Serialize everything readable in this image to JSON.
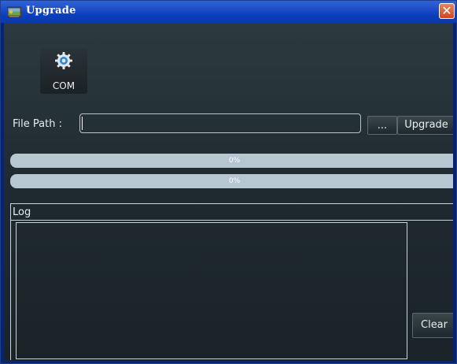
{
  "window": {
    "title": "Upgrade",
    "close_glyph": "✕"
  },
  "toolbar": {
    "com_label": "COM",
    "com_icon": "gear-icon"
  },
  "file_path": {
    "label": "File Path :",
    "value": "",
    "placeholder": ""
  },
  "buttons": {
    "browse": "...",
    "upgrade": "Upgrade",
    "clear": "Clear"
  },
  "progress": [
    {
      "value": 0,
      "label": "0%"
    },
    {
      "value": 0,
      "label": "0%"
    }
  ],
  "log": {
    "header": "Log",
    "content": ""
  },
  "colors": {
    "titlebar": "#1f4fc8",
    "close": "#d2461f",
    "background": "#1f2a30",
    "progress_track": "#b7c7d1"
  }
}
